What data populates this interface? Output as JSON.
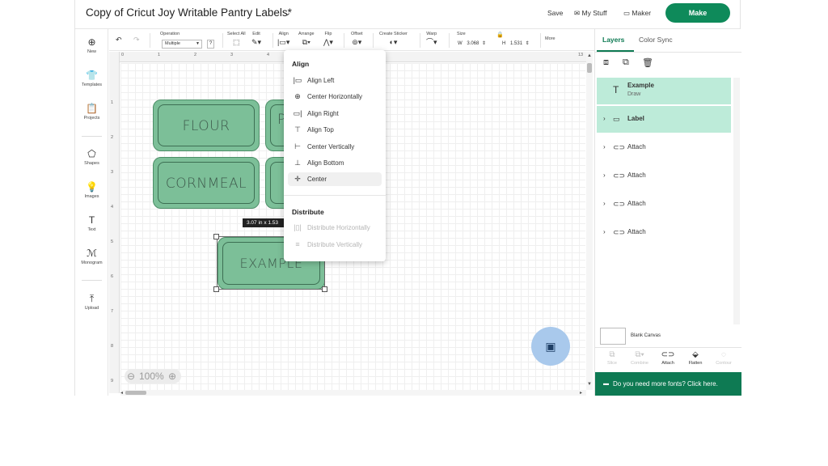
{
  "header": {
    "title": "Copy of Cricut Joy Writable Pantry Labels*",
    "save_label": "Save",
    "my_stuff_label": "My Stuff",
    "maker_label": "Maker",
    "make_label": "Make"
  },
  "left_rail": [
    {
      "label": "New",
      "icon": "plus-circle-icon"
    },
    {
      "label": "Templates",
      "icon": "shirt-icon"
    },
    {
      "label": "Projects",
      "icon": "clipboard-icon"
    },
    {
      "label": "Shapes",
      "icon": "shapes-icon"
    },
    {
      "label": "Images",
      "icon": "bulb-icon"
    },
    {
      "label": "Text",
      "icon": "text-icon"
    },
    {
      "label": "Monogram",
      "icon": "monogram-icon"
    },
    {
      "label": "Upload",
      "icon": "upload-icon"
    }
  ],
  "toolbar": {
    "operation_label": "Operation",
    "operation_value": "Multiple",
    "help": "?",
    "select_all_label": "Select All",
    "edit_label": "Edit",
    "align_label": "Align",
    "arrange_label": "Arrange",
    "flip_label": "Flip",
    "offset_label": "Offset",
    "create_sticker_label": "Create Sticker",
    "warp_label": "Warp",
    "size_label": "Size",
    "width_prefix": "W",
    "width_value": "3.068",
    "height_prefix": "H",
    "height_value": "1.531",
    "more_label": "More"
  },
  "ruler": {
    "top_numbers": [
      "0",
      "1",
      "2",
      "3",
      "4",
      "13"
    ],
    "left_numbers": [
      "1",
      "2",
      "3",
      "4",
      "5",
      "6",
      "7",
      "8",
      "9"
    ]
  },
  "canvas": {
    "labels": [
      {
        "text": "FLOUR"
      },
      {
        "text": "P"
      },
      {
        "text": "CORNMEAL"
      },
      {
        "text": ""
      },
      {
        "text": "EXAMPLE"
      }
    ],
    "dimension_tip": "3.07  in x 1.53",
    "zoom": "100%"
  },
  "align_menu": {
    "align_heading": "Align",
    "items": [
      {
        "label": "Align Left",
        "icon": "align-left-icon",
        "glyph": "|▭"
      },
      {
        "label": "Center Horizontally",
        "icon": "center-horizontally-icon",
        "glyph": "⊕"
      },
      {
        "label": "Align Right",
        "icon": "align-right-icon",
        "glyph": "▭|"
      },
      {
        "label": "Align Top",
        "icon": "align-top-icon",
        "glyph": "⊤"
      },
      {
        "label": "Center Vertically",
        "icon": "center-vertically-icon",
        "glyph": "⊢"
      },
      {
        "label": "Align Bottom",
        "icon": "align-bottom-icon",
        "glyph": "⊥"
      },
      {
        "label": "Center",
        "icon": "center-icon",
        "glyph": "✛"
      }
    ],
    "distribute_heading": "Distribute",
    "distribute_items": [
      {
        "label": "Distribute Horizontally",
        "icon": "distribute-horizontally-icon",
        "glyph": "|▯|"
      },
      {
        "label": "Distribute Vertically",
        "icon": "distribute-vertically-icon",
        "glyph": "≡"
      }
    ]
  },
  "right_panel": {
    "tabs": [
      {
        "label": "Layers"
      },
      {
        "label": "Color Sync"
      }
    ],
    "layers": [
      {
        "name": "Example",
        "sub": "Draw",
        "icon": "text-layer-icon",
        "selected": true
      },
      {
        "name": "Label",
        "icon": "shape-layer-icon",
        "selected": true
      },
      {
        "name": "Attach",
        "icon": "attach-icon",
        "selected": false
      },
      {
        "name": "Attach",
        "icon": "attach-icon",
        "selected": false
      },
      {
        "name": "Attach",
        "icon": "attach-icon",
        "selected": false
      },
      {
        "name": "Attach",
        "icon": "attach-icon",
        "selected": false
      }
    ],
    "blank_canvas_label": "Blank Canvas",
    "bottom_tools": [
      {
        "label": "Slice",
        "icon": "slice-icon",
        "enabled": false
      },
      {
        "label": "Combine",
        "icon": "combine-icon",
        "enabled": false
      },
      {
        "label": "Attach",
        "icon": "attach-icon",
        "enabled": true
      },
      {
        "label": "Flatten",
        "icon": "flatten-icon",
        "enabled": true
      },
      {
        "label": "Contour",
        "icon": "contour-icon",
        "enabled": false
      }
    ],
    "fonts_banner": "Do you need more fonts? Click here."
  },
  "colors": {
    "accent": "#0e8a5a",
    "label_fill": "#7cbf98",
    "layer_selected": "#bdebd9",
    "chat_button": "#a9c9ec"
  }
}
